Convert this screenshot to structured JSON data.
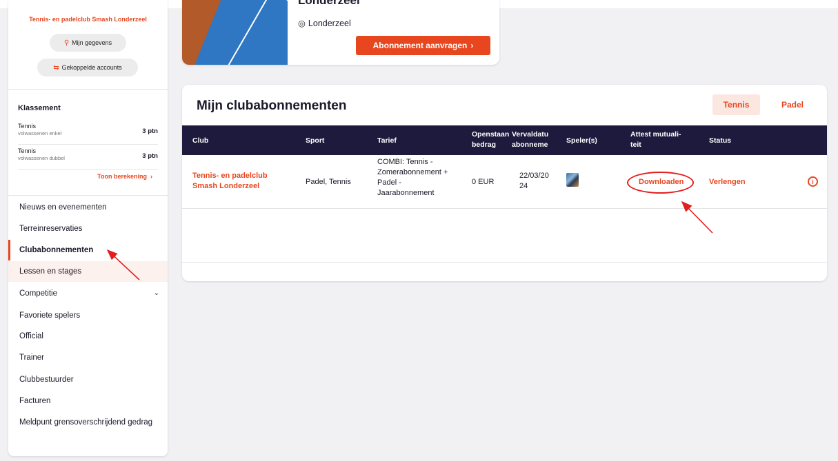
{
  "sidebar": {
    "club_name": "Tennis- en padelclub Smash Londerzeel",
    "buttons": [
      {
        "label": "Mijn gegevens",
        "icon": "user-icon"
      },
      {
        "label": "Gekoppelde accounts",
        "icon": "link-accounts-icon"
      }
    ],
    "klassement": {
      "title": "Klassement",
      "rows": [
        {
          "name": "Tennis",
          "sub": "volwassenen enkel",
          "points": "3 ptn"
        },
        {
          "name": "Tennis",
          "sub": "volwassenen dubbel",
          "points": "3 ptn"
        }
      ],
      "toon_berekening": "Toon berekening"
    },
    "nav": [
      {
        "label": "Nieuws en evenementen"
      },
      {
        "label": "Terreinreservaties"
      },
      {
        "label": "Clubabonnementen",
        "active": true
      },
      {
        "label": "Lessen en stages"
      },
      {
        "label": "Competitie",
        "has_chevron": true
      },
      {
        "label": "Favoriete spelers"
      },
      {
        "label": "Official"
      },
      {
        "label": "Trainer"
      },
      {
        "label": "Clubbestuurder"
      },
      {
        "label": "Facturen"
      },
      {
        "label": "Meldpunt grensoverschrijdend gedrag"
      }
    ]
  },
  "club_card": {
    "title": "Londerzeel",
    "location": "Londerzeel",
    "button_label": "Abonnement aanvragen"
  },
  "subscriptions": {
    "title": "Mijn clubabonnementen",
    "tabs": [
      {
        "label": "Tennis",
        "selected": true
      },
      {
        "label": "Padel",
        "selected": false
      }
    ],
    "columns": [
      "Club",
      "Sport",
      "Tarief",
      "Openstaand bedrag",
      "Vervaldatum abonnement",
      "Speler(s)",
      "Attest mutualiteit",
      "Status"
    ],
    "column_display": {
      "club": "Club",
      "sport": "Sport",
      "tarief": "Tarief",
      "openstaand_1": "Openstaan",
      "openstaand_2": "bedrag",
      "verval_1": "Vervaldatu",
      "verval_2": "abonneme",
      "spelers": "Speler(s)",
      "attest_1": "Attest mutuali-",
      "attest_2": "teit",
      "status": "Status"
    },
    "rows": [
      {
        "club_1": "Tennis- en padelclub",
        "club_2": "Smash Londerzeel",
        "sport": "Padel, Tennis",
        "tarief_1": "COMBI: Tennis -",
        "tarief_2": "Zomerabonnement +",
        "tarief_3": "Padel -",
        "tarief_4": "Jaarabonnement",
        "bedrag": "0 EUR",
        "vervaldatum_1": "22/03/20",
        "vervaldatum_2": "24",
        "attest": "Downloaden",
        "status": "Verlengen",
        "info_icon": "info-icon"
      }
    ]
  },
  "colors": {
    "accent": "#e8461e",
    "header_bg": "#1e1a3d",
    "annotation": "#e02020"
  }
}
